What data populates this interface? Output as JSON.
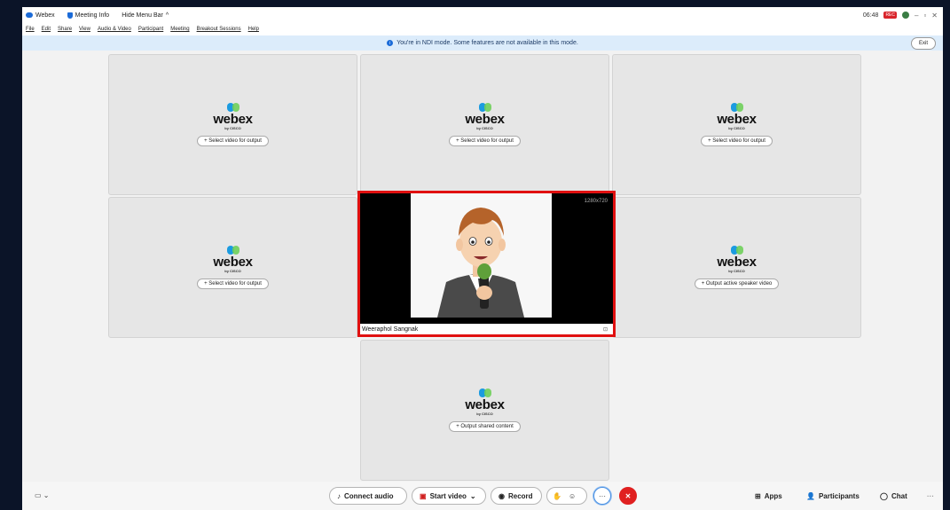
{
  "titlebar": {
    "app_name": "Webex",
    "meeting_info": "Meeting Info",
    "hide_menu": "Hide Menu Bar",
    "hide_menu_chevron": "^",
    "time": "06:48",
    "rec_badge": "REC",
    "minimize": "–",
    "restore": "▫",
    "close": "✕"
  },
  "menu": {
    "items": [
      "File",
      "Edit",
      "Share",
      "View",
      "Audio & Video",
      "Participant",
      "Meeting",
      "Breakout Sessions",
      "Help"
    ]
  },
  "banner": {
    "message": "You're in NDI mode. Some features are not available in this mode.",
    "exit_label": "Exit"
  },
  "tiles": {
    "logo_word": "webex",
    "logo_sub": "by CISCO",
    "select_video": "+ Select video for output",
    "active_speaker": "+ Output active speaker video",
    "shared_content": "+ Output shared content"
  },
  "video": {
    "resolution": "1280x720",
    "participant_name": "Weeraphol Sangnak"
  },
  "bottombar": {
    "connect_audio": "Connect audio",
    "start_video": "Start video",
    "record": "Record",
    "more": "···",
    "apps": "Apps",
    "participants": "Participants",
    "chat": "Chat",
    "overflow": "···"
  },
  "colors": {
    "accent": "#1b6bd8",
    "end_call": "#e02020",
    "highlight_border": "#e01010"
  }
}
